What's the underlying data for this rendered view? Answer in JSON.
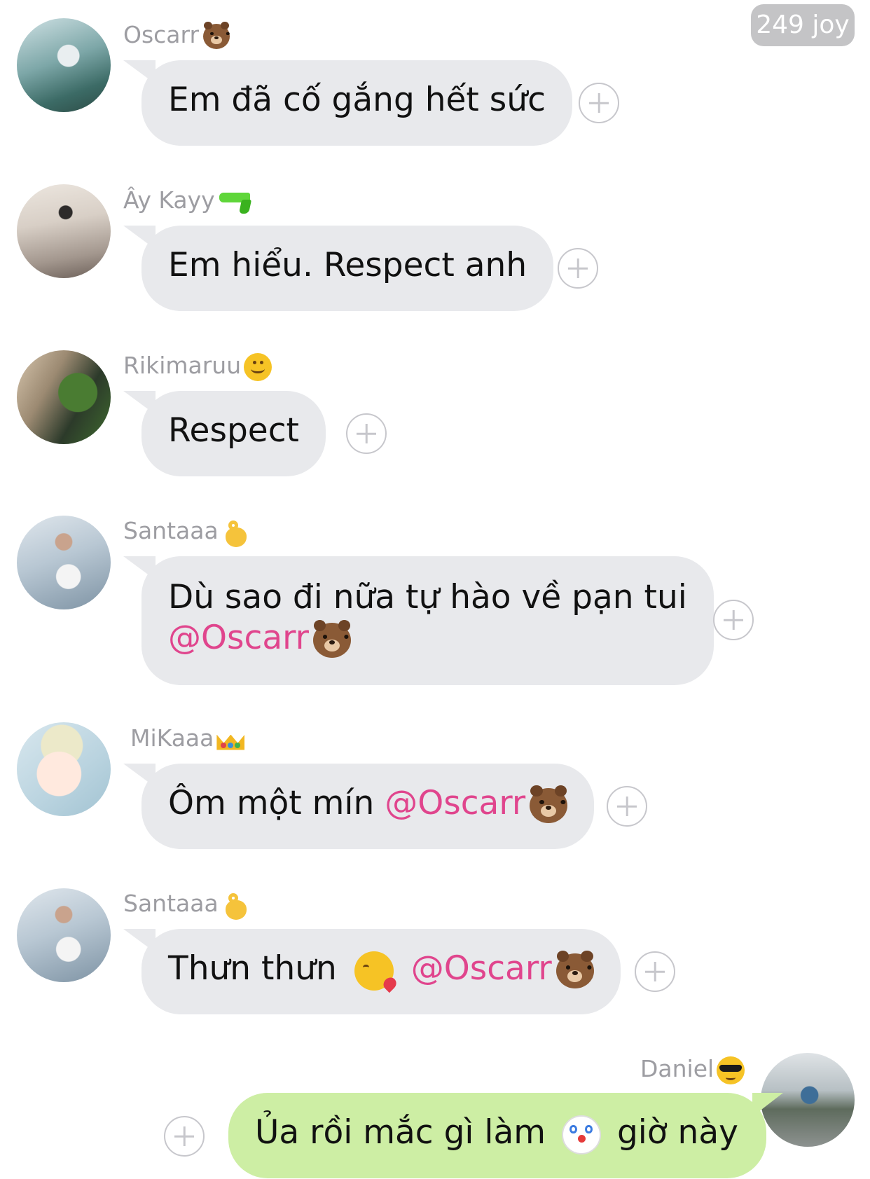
{
  "header": {
    "joy_count": "249 joy"
  },
  "messages": [
    {
      "sender": "Oscarr",
      "sender_emoji": "bear-emoji",
      "text": "Em đã cố gắng hết sức"
    },
    {
      "sender": "Ây Kayy",
      "sender_emoji": "water-pistol-emoji",
      "text": "Em hiểu. Respect anh"
    },
    {
      "sender": "Rikimaruu",
      "sender_emoji": "upside-down-face-emoji",
      "text": "Respect"
    },
    {
      "sender": "Santaaa",
      "sender_emoji": "ok-hand-emoji",
      "text_line1": "Dù sao đi nữa tự hào về pạn tui",
      "mention": "@Oscarr"
    },
    {
      "sender": "MiKaaa",
      "sender_emoji": "crown-emoji",
      "text": "Ôm một mín",
      "mention": "@Oscarr"
    },
    {
      "sender": "Santaaa",
      "sender_emoji": "ok-hand-emoji",
      "text": "Thưn thưn",
      "text_emoji": "kissing-heart-emoji",
      "mention": "@Oscarr"
    },
    {
      "sender": "Daniel",
      "sender_emoji": "sunglasses-emoji",
      "text_before": "Ủa rồi mắc gì làm",
      "text_emoji": "clown-emoji",
      "text_after": "giờ này",
      "outgoing": true
    }
  ],
  "colors": {
    "incoming_bubble": "#e8e9ec",
    "outgoing_bubble": "#cdeea4",
    "mention": "#e0458d",
    "sender_name": "#9d9da2",
    "joy_badge": "#c4c4c6"
  }
}
